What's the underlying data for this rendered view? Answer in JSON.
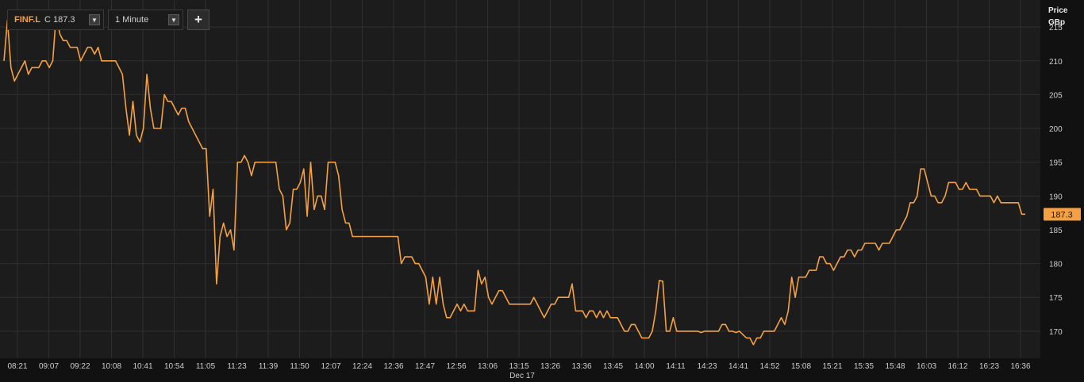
{
  "toolbar": {
    "symbol": "FINF.L",
    "close_label": "C 187.3",
    "interval": "1 Minute",
    "add_label": "+"
  },
  "axis": {
    "y_title_line1": "Price",
    "y_title_line2": "GBp",
    "date_label": "Dec 17",
    "last_price_label": "187.3"
  },
  "colors": {
    "line": "#f5a142",
    "background": "#1c1c1c",
    "grid": "#2f2f2f",
    "tag": "#f5a142"
  },
  "chart_data": {
    "type": "line",
    "title": "",
    "xlabel": "Dec 17",
    "ylabel": "Price GBp",
    "ylim": [
      166,
      219
    ],
    "grid": true,
    "y_ticks": [
      170,
      175,
      180,
      185,
      190,
      195,
      200,
      205,
      210,
      215
    ],
    "x_tick_labels": [
      "08:21",
      "09:07",
      "09:22",
      "10:08",
      "10:41",
      "10:54",
      "11:05",
      "11:23",
      "11:39",
      "11:50",
      "12:07",
      "12:24",
      "12:36",
      "12:47",
      "12:56",
      "13:06",
      "13:15",
      "13:26",
      "13:36",
      "13:45",
      "14:00",
      "14:11",
      "14:23",
      "14:41",
      "14:52",
      "15:08",
      "15:21",
      "15:35",
      "15:48",
      "16:03",
      "16:12",
      "16:23",
      "16:36"
    ],
    "last_value": 187.3,
    "series": [
      {
        "values": [
          210,
          216,
          209,
          207,
          208,
          209,
          210,
          208,
          209,
          209,
          209,
          210,
          210,
          209,
          210,
          217,
          214,
          213,
          213,
          212,
          212,
          212,
          210,
          211,
          212,
          212,
          211,
          212,
          210,
          210,
          210,
          210,
          210,
          209,
          208,
          203,
          199,
          204,
          199,
          198,
          200,
          208,
          203,
          200,
          200,
          200,
          205,
          204,
          204,
          203,
          202,
          203,
          203,
          201,
          200,
          199,
          198,
          197,
          197,
          187,
          191,
          177,
          184,
          186,
          184,
          185,
          182,
          195,
          195,
          196,
          195,
          193,
          195,
          195,
          195,
          195,
          195,
          195,
          195,
          191,
          190,
          185,
          186,
          191,
          191,
          192,
          194,
          187,
          195,
          188,
          190,
          190,
          188,
          195,
          195,
          195,
          193,
          188,
          186,
          186,
          184,
          184,
          184,
          184,
          184,
          184,
          184,
          184,
          184,
          184,
          184,
          184,
          184,
          184,
          180,
          181,
          181,
          181,
          180,
          180,
          179,
          178,
          174,
          178,
          174,
          178,
          174,
          172,
          172,
          173,
          174,
          173,
          174,
          173,
          173,
          173,
          179,
          177,
          178,
          175,
          174,
          175,
          176,
          176,
          175,
          174,
          174,
          174,
          174,
          174,
          174,
          174,
          175,
          174,
          173,
          172,
          173,
          174,
          174,
          175,
          175,
          175,
          175,
          177,
          173,
          173,
          173,
          172,
          173,
          173,
          172,
          173,
          172,
          173,
          172,
          172,
          172,
          171,
          170,
          170,
          171,
          171,
          170,
          169,
          169,
          169,
          170,
          173,
          177.5,
          177.4,
          170,
          170,
          172,
          170,
          170,
          170,
          170,
          170,
          170,
          170,
          169.8,
          170,
          170,
          170,
          170,
          170,
          171,
          171,
          170,
          170,
          169.8,
          170,
          169.5,
          169,
          169,
          168,
          169,
          169,
          170,
          170,
          170,
          170,
          171,
          172,
          171,
          173,
          178,
          175,
          178,
          178,
          178,
          179,
          179,
          179,
          181,
          181,
          180,
          180,
          179,
          180,
          181,
          181,
          182,
          182,
          181,
          182,
          182,
          183,
          183,
          183,
          183,
          182,
          183,
          183,
          183,
          184,
          185,
          185,
          186,
          187,
          189,
          189,
          190,
          194,
          194,
          192,
          190,
          190,
          189,
          189,
          190,
          192,
          192,
          192,
          191,
          191,
          192,
          191,
          191,
          191,
          190,
          190,
          190,
          190,
          189,
          190,
          189,
          189,
          189,
          189,
          189,
          189,
          187.3,
          187.3
        ]
      }
    ]
  }
}
